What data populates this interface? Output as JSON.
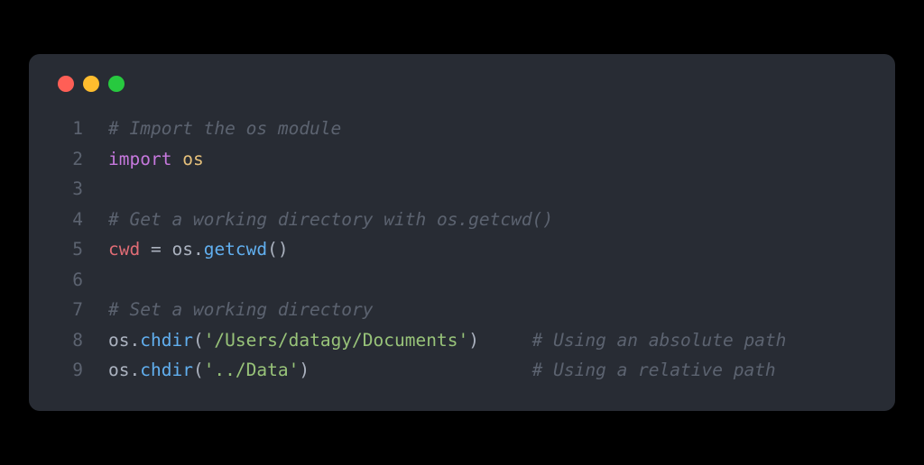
{
  "window": {
    "controls": [
      "close",
      "minimize",
      "maximize"
    ]
  },
  "code": {
    "lines": [
      {
        "n": "1",
        "tokens": [
          {
            "t": "# Import the os module",
            "c": "comment"
          }
        ]
      },
      {
        "n": "2",
        "tokens": [
          {
            "t": "import",
            "c": "keyword"
          },
          {
            "t": " ",
            "c": ""
          },
          {
            "t": "os",
            "c": "module"
          }
        ]
      },
      {
        "n": "3",
        "tokens": []
      },
      {
        "n": "4",
        "tokens": [
          {
            "t": "# Get a working directory with os.getcwd()",
            "c": "comment"
          }
        ]
      },
      {
        "n": "5",
        "tokens": [
          {
            "t": "cwd ",
            "c": "variable"
          },
          {
            "t": "=",
            "c": "operator"
          },
          {
            "t": " os",
            "c": "identifier"
          },
          {
            "t": ".",
            "c": "operator"
          },
          {
            "t": "getcwd",
            "c": "function"
          },
          {
            "t": "()",
            "c": "paren"
          }
        ]
      },
      {
        "n": "6",
        "tokens": []
      },
      {
        "n": "7",
        "tokens": [
          {
            "t": "# Set a working directory",
            "c": "comment"
          }
        ]
      },
      {
        "n": "8",
        "tokens": [
          {
            "t": "os",
            "c": "identifier"
          },
          {
            "t": ".",
            "c": "operator"
          },
          {
            "t": "chdir",
            "c": "function"
          },
          {
            "t": "(",
            "c": "paren"
          },
          {
            "t": "'/Users/datagy/Documents'",
            "c": "string"
          },
          {
            "t": ")",
            "c": "paren"
          },
          {
            "t": "     ",
            "c": ""
          },
          {
            "t": "# Using an absolute path",
            "c": "comment"
          }
        ]
      },
      {
        "n": "9",
        "tokens": [
          {
            "t": "os",
            "c": "identifier"
          },
          {
            "t": ".",
            "c": "operator"
          },
          {
            "t": "chdir",
            "c": "function"
          },
          {
            "t": "(",
            "c": "paren"
          },
          {
            "t": "'../Data'",
            "c": "string"
          },
          {
            "t": ")",
            "c": "paren"
          },
          {
            "t": "                     ",
            "c": ""
          },
          {
            "t": "# Using a relative path",
            "c": "comment"
          }
        ]
      }
    ]
  }
}
